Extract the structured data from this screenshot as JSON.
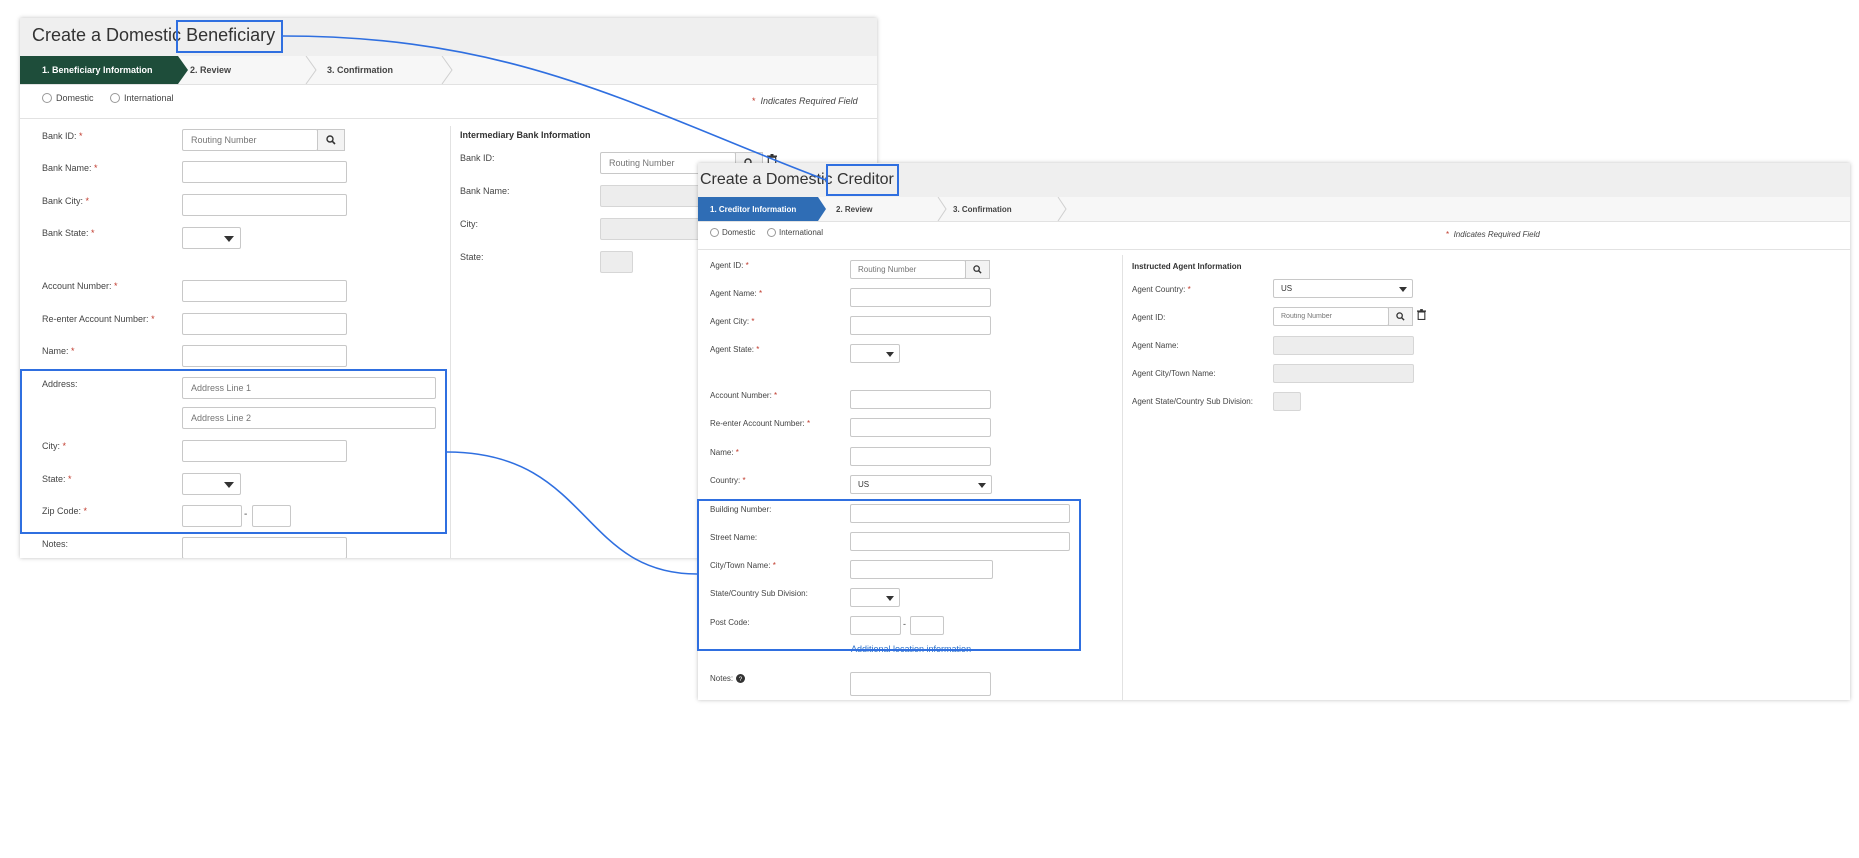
{
  "left_panel": {
    "title_prefix": "Create a Domestic",
    "title_highlight": "Beneficiary",
    "steps": [
      "1. Beneficiary Information",
      "2. Review",
      "3. Confirmation"
    ],
    "radio_domestic": "Domestic",
    "radio_international": "International",
    "required_note": "Indicates Required Field",
    "bank_id_label": "Bank ID:",
    "bank_id_placeholder": "Routing Number",
    "bank_name_label": "Bank Name:",
    "bank_city_label": "Bank City:",
    "bank_state_label": "Bank State:",
    "account_number_label": "Account Number:",
    "reenter_account_label": "Re-enter Account Number:",
    "name_label": "Name:",
    "address_label": "Address:",
    "address_line1_placeholder": "Address Line 1",
    "address_line2_placeholder": "Address Line 2",
    "city_label": "City:",
    "state_label": "State:",
    "zip_label": "Zip Code:",
    "zip_separator": "-",
    "notes_label": "Notes:",
    "intermediary_title": "Intermediary Bank Information",
    "int_bank_id_label": "Bank ID:",
    "int_bank_id_placeholder": "Routing Number",
    "int_bank_name_label": "Bank Name:",
    "int_city_label": "City:",
    "int_state_label": "State:"
  },
  "right_panel": {
    "title_prefix": "Create a Domestic",
    "title_highlight": "Creditor",
    "steps": [
      "1. Creditor Information",
      "2. Review",
      "3. Confirmation"
    ],
    "radio_domestic": "Domestic",
    "radio_international": "International",
    "required_note": "Indicates Required Field",
    "agent_id_label": "Agent ID:",
    "agent_id_placeholder": "Routing Number",
    "agent_name_label": "Agent Name:",
    "agent_city_label": "Agent City:",
    "agent_state_label": "Agent State:",
    "account_number_label": "Account Number:",
    "reenter_account_label": "Re-enter Account Number:",
    "name_label": "Name:",
    "country_label": "Country:",
    "country_value": "US",
    "building_number_label": "Building Number:",
    "street_name_label": "Street Name:",
    "city_town_label": "City/Town Name:",
    "state_country_sub_label": "State/Country Sub Division:",
    "post_code_label": "Post Code:",
    "post_code_separator": "-",
    "additional_location_link": "Additional location information",
    "notes_label": "Notes:",
    "instructed_title": "Instructed Agent Information",
    "ia_country_label": "Agent Country:",
    "ia_country_value": "US",
    "ia_agent_id_label": "Agent ID:",
    "ia_agent_id_placeholder": "Routing Number",
    "ia_agent_name_label": "Agent Name:",
    "ia_city_town_label": "Agent City/Town Name:",
    "ia_state_sub_label": "Agent State/Country Sub Division:"
  },
  "colors": {
    "left_active_step": "#1e4d3a",
    "right_active_step": "#2f6db5",
    "highlight_border": "#2f6fe0",
    "required_star": "#c0392b"
  },
  "icons": {
    "search": "search-icon",
    "trash": "trash-icon",
    "caret": "chevron-down-icon",
    "help": "help-icon"
  }
}
